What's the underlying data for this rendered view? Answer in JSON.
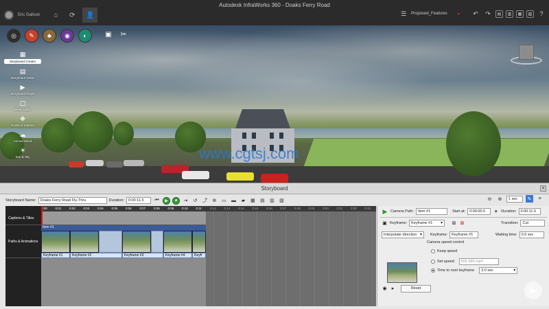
{
  "window": {
    "title": "Autodesk InfraWorks 360 - Doaks Ferry Road"
  },
  "user": {
    "name": "Eric Gallson"
  },
  "proposal": {
    "selected": "Proposed_Features"
  },
  "viewport": {
    "watermark": "www.cgtsj.com"
  },
  "left_toolbar": {
    "items": [
      {
        "label": "Storyboard Creator",
        "icon": "storyboard-creator-icon",
        "active": true
      },
      {
        "label": "Storyboard Writer",
        "icon": "storyboard-writer-icon"
      },
      {
        "label": "Storyboard Player",
        "icon": "storyboard-player-icon"
      },
      {
        "label": "Watermarks",
        "icon": "watermark-icon"
      },
      {
        "label": "Points of Interest",
        "icon": "poi-icon"
      },
      {
        "label": "Annual Mood",
        "icon": "mood-icon"
      },
      {
        "label": "Sun & Sky",
        "icon": "sun-sky-icon"
      }
    ]
  },
  "storyboard": {
    "title": "Storyboard",
    "name_label": "Storyboard Name:",
    "name_value": "Doaks Ferry Road Fly-Thru",
    "duration_label": "Duration:",
    "duration_value": "0:00:11.5",
    "zoom_value": "1 sec",
    "timeline": {
      "ticks": [
        "0:00",
        "0:01",
        "0:02",
        "0:03",
        "0:04",
        "0:05",
        "0:06",
        "0:07",
        "0:08",
        "0:09",
        "0:10",
        "0:11",
        "0:12",
        "0:13",
        "0:14",
        "0:15",
        "0:16",
        "0:17",
        "0:18",
        "0:19",
        "0:20",
        "0:21",
        "0:22",
        "0:23",
        "0:24"
      ],
      "rows": [
        "Captions & Titles",
        "Paths & Animations"
      ],
      "item_label": "Item #1",
      "keyframes": [
        "Keyframe #1",
        "Keyframe #2",
        "Keyframe #3",
        "Keyframe #4",
        "Keyfr"
      ]
    },
    "properties": {
      "camera_path_label": "Camera Path:",
      "camera_path_value": "Item #1",
      "start_at_label": "Start at:",
      "start_at_value": "0:00:00.0",
      "duration_label": "Duration:",
      "duration_value": "0:00:11.5",
      "keyframe_label": "Keyframe:",
      "keyframe_value": "Keyframe #1",
      "transition_label": "Transition:",
      "transition_value": "Cut",
      "interpolate_value": "Interpolate direction",
      "keyframe2_label": "Keyframe:",
      "keyframe2_value": "Keyframe #1",
      "waiting_label": "Waiting time:",
      "waiting_value": "0.0 sec",
      "speed_section": "Camera speed control",
      "keep_speed": "Keep speed",
      "set_speed": "Set speed",
      "set_speed_value": "555.586 mph",
      "time_next": "Time to next keyframe",
      "time_next_value": "3.0 sec",
      "reset": "Reset"
    }
  }
}
